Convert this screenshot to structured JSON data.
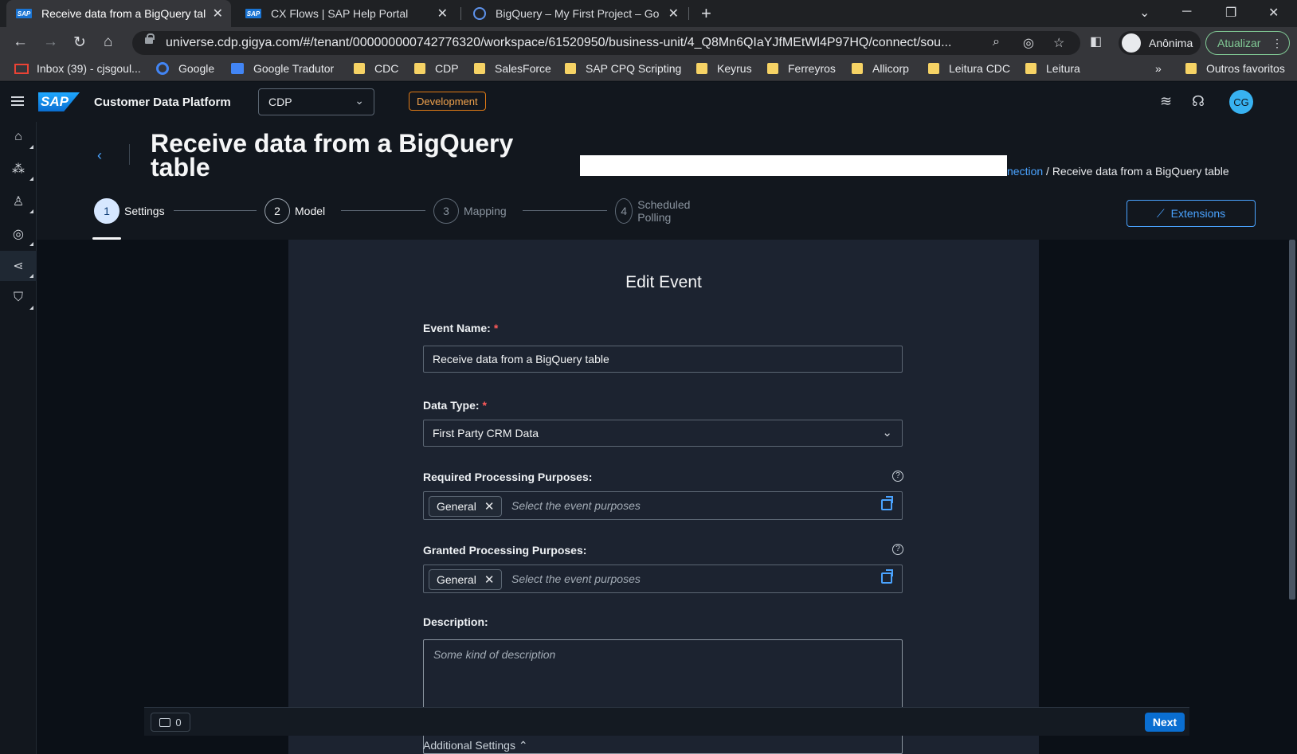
{
  "browser": {
    "tabs": [
      {
        "title": "Receive data from a BigQuery tal",
        "favicon": "SAP"
      },
      {
        "title": "CX Flows | SAP Help Portal",
        "favicon": "SAP"
      },
      {
        "title": "BigQuery – My First Project – Go",
        "favicon": ""
      }
    ],
    "url": "universe.cdp.gigya.com/#/tenant/000000000742776320/workspace/61520950/business-unit/4_Q8Mn6QIaYJfMEtWl4P97HQ/connect/sou...",
    "profile_label": "Anônima",
    "update_label": "Atualizar",
    "bookmarks": [
      "Inbox (39) - cjsgoul...",
      "Google",
      "Google Tradutor",
      "CDC",
      "CDP",
      "SalesForce",
      "SAP CPQ Scripting",
      "Keyrus",
      "Ferreyros",
      "Allicorp",
      "Leitura CDC",
      "Leitura"
    ],
    "bookmarks_more": "»",
    "other_bookmarks": "Outros favoritos"
  },
  "app": {
    "logo_text": "SAP",
    "product_name": "Customer Data Platform",
    "tenant": "CDP",
    "environment": "Development",
    "avatar_initials": "CG"
  },
  "page": {
    "title": "Receive data from a BigQuery table",
    "breadcrumb_link": "nection",
    "breadcrumb_current": " / Receive data from a BigQuery table",
    "extensions_label": "Extensions"
  },
  "steps": [
    {
      "num": "1",
      "label": "Settings"
    },
    {
      "num": "2",
      "label": "Model"
    },
    {
      "num": "3",
      "label": "Mapping"
    },
    {
      "num": "4",
      "label": "Scheduled Polling"
    }
  ],
  "form": {
    "title": "Edit Event",
    "event_name_label": "Event Name:",
    "event_name_value": "Receive data from a BigQuery table",
    "data_type_label": "Data Type:",
    "data_type_value": "First Party CRM Data",
    "required_purposes_label": "Required Processing Purposes:",
    "granted_purposes_label": "Granted Processing Purposes:",
    "purpose_token": "General",
    "purposes_placeholder": "Select the event purposes",
    "description_label": "Description:",
    "description_placeholder": "Some kind of description",
    "required_marker": "*",
    "help_glyph": "?"
  },
  "footer": {
    "message_count": "0",
    "next_label": "Next",
    "additional_settings": "Additional Settings"
  }
}
